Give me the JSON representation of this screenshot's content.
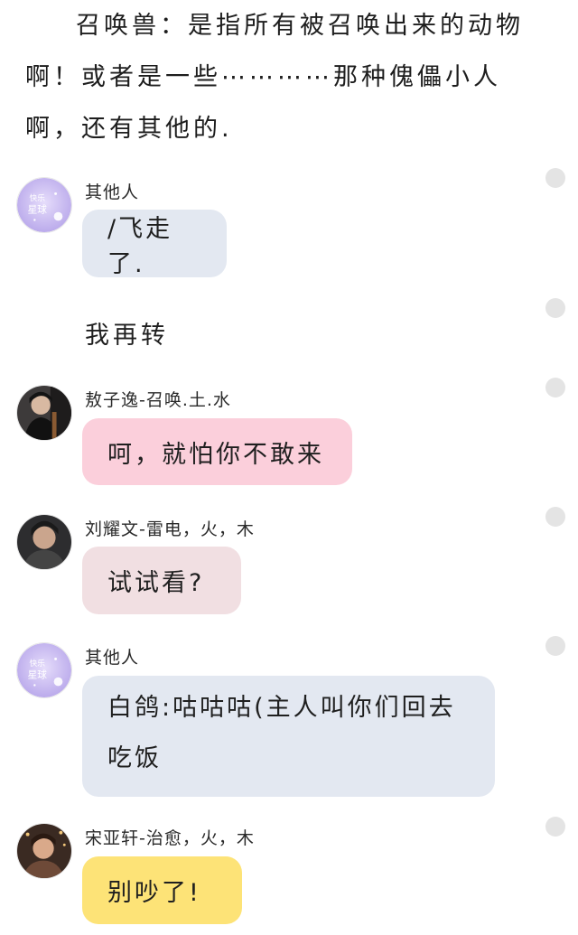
{
  "colors": {
    "bubble_blue": "#e3e8f1",
    "bubble_pink": "#fbcfdb",
    "bubble_rose": "#f1dfe2",
    "bubble_yellow": "#fde377",
    "side_dot": "#e4e4e4"
  },
  "narration": {
    "lines": "召唤兽：是指所有被召唤出来的动物啊！或者是一些⋯⋯⋯⋯那种傀儡小人啊，还有其他的."
  },
  "messages": [
    {
      "sender": "其他人",
      "avatar": "planet-sticker-avatar",
      "text": "/飞走了."
    },
    {
      "text": "我再转"
    },
    {
      "sender": "敖子逸-召唤.土.水",
      "avatar": "boy-guitar-avatar",
      "text": "呵，就怕你不敢来"
    },
    {
      "sender": "刘耀文-雷电，火，木",
      "avatar": "boy-portrait-avatar",
      "text": "试试看?"
    },
    {
      "sender": "其他人",
      "avatar": "planet-sticker-avatar",
      "text": "白鸽:咕咕咕(主人叫你们回去吃饭"
    },
    {
      "sender": "宋亚轩-治愈，火，木",
      "avatar": "boy-night-avatar",
      "text": "别吵了!"
    }
  ]
}
